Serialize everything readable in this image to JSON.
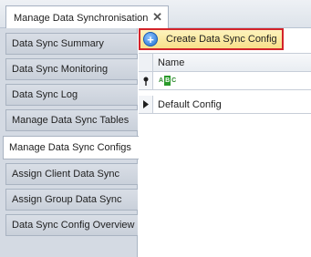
{
  "tab": {
    "title": "Manage Data Synchronisation",
    "close_glyph": "✕"
  },
  "sidebar": {
    "items": [
      {
        "label": "Data Sync Summary"
      },
      {
        "label": "Data Sync Monitoring"
      },
      {
        "label": "Data Sync Log"
      },
      {
        "label": "Manage Data Sync Tables"
      },
      {
        "label": "Manage Data Sync Configs"
      },
      {
        "label": "Assign Client Data Sync"
      },
      {
        "label": "Assign Group Data Sync"
      },
      {
        "label": "Data Sync Config Overview"
      }
    ],
    "active_index": 4
  },
  "toolbar": {
    "create_label": "Create Data Sync Config",
    "create_icon": "add-circle-icon"
  },
  "grid": {
    "column_header": "Name",
    "filter_row_icon": "abc-text-filter-icon",
    "rows": [
      {
        "name": "Default Config"
      }
    ]
  },
  "colors": {
    "highlight_border": "#d3232a",
    "button_fill": "#f8e08a",
    "sidebar_bg": "#d4dae3"
  }
}
